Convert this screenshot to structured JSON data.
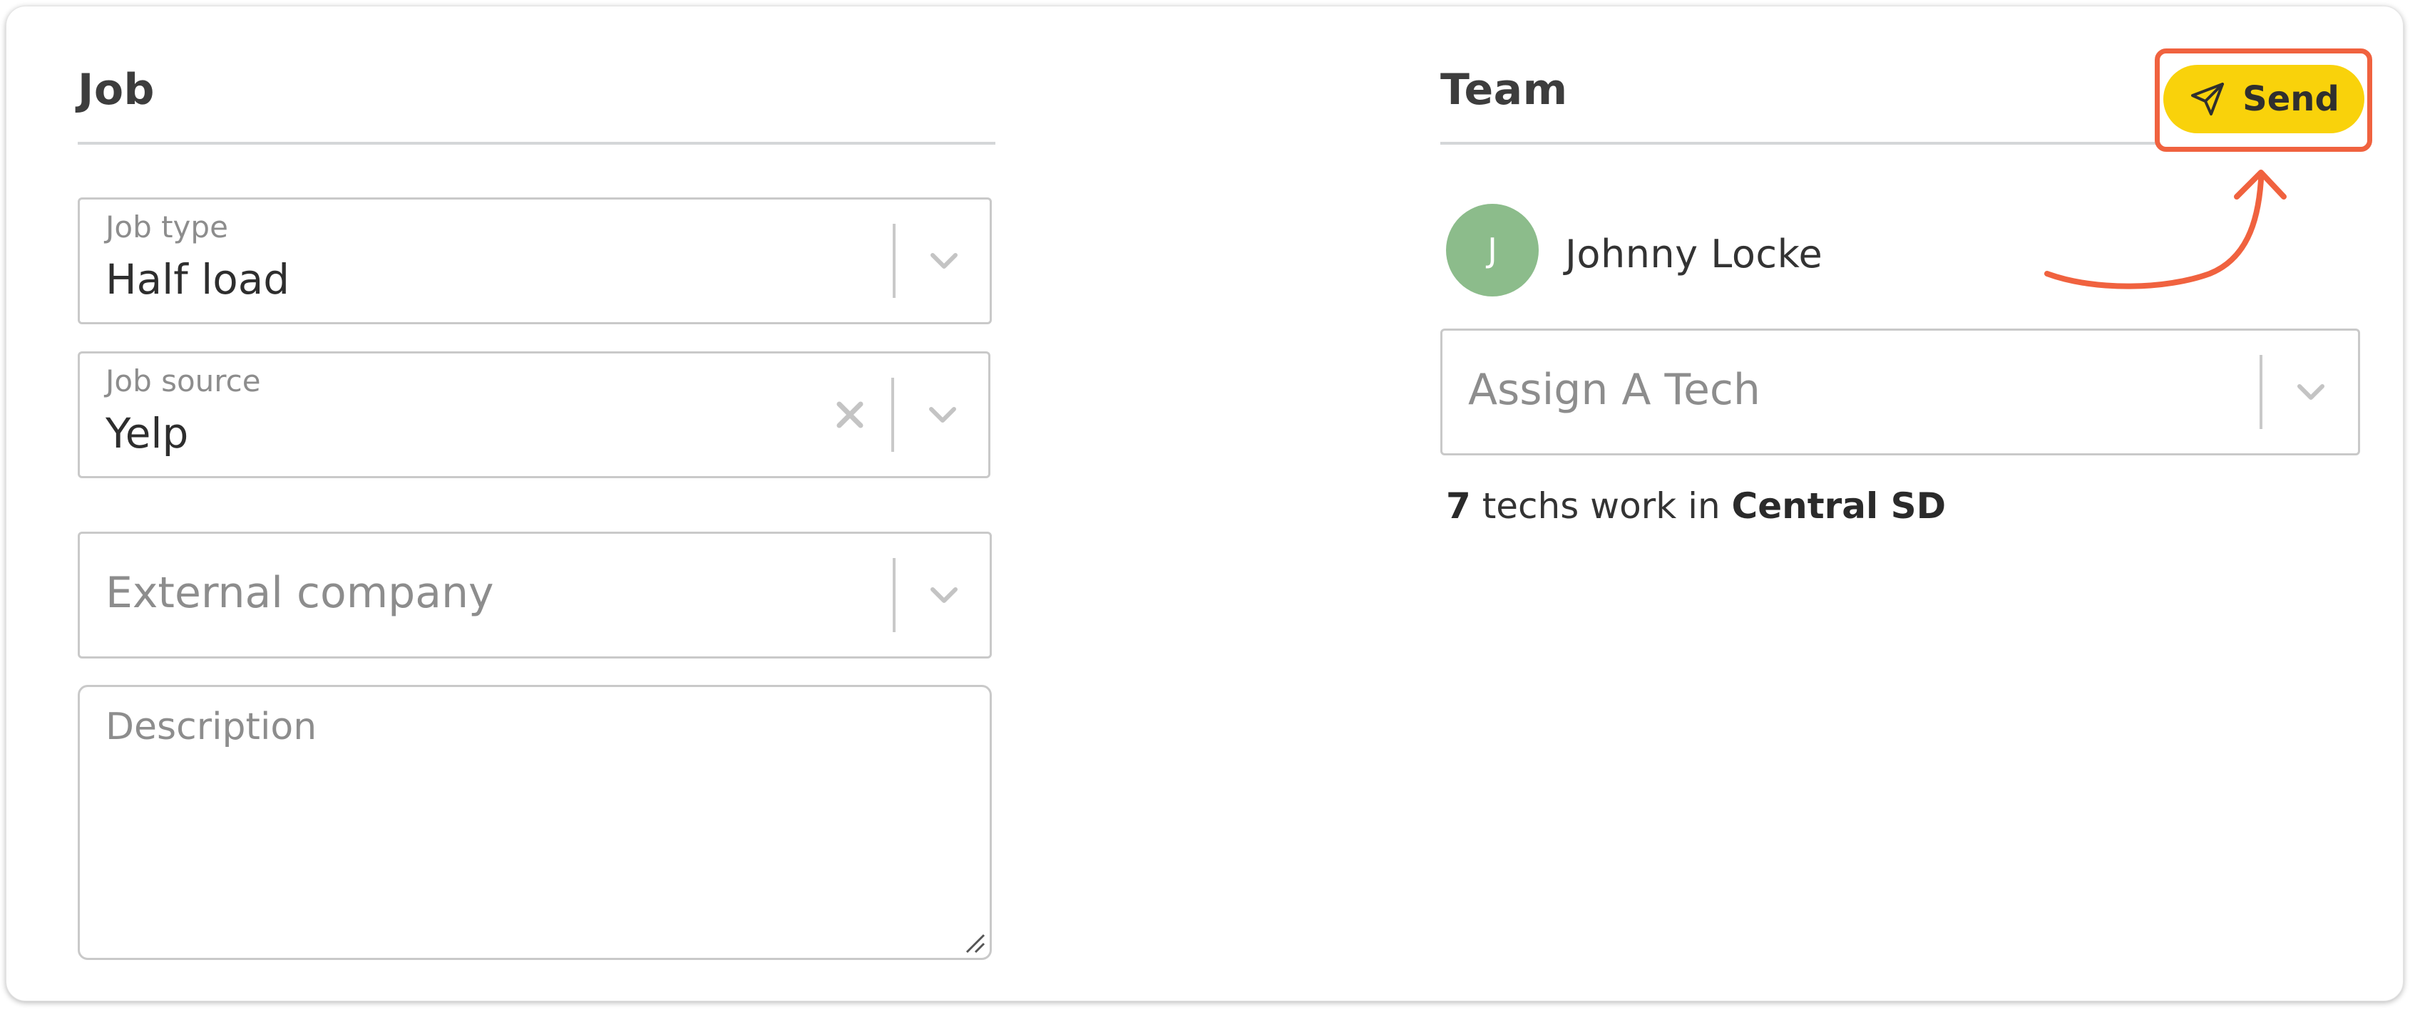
{
  "job": {
    "title": "Job",
    "job_type": {
      "label": "Job type",
      "value": "Half load"
    },
    "job_source": {
      "label": "Job source",
      "value": "Yelp"
    },
    "external_company": {
      "placeholder": "External company"
    },
    "description": {
      "placeholder": "Description"
    }
  },
  "team": {
    "title": "Team",
    "send_label": "Send",
    "member": {
      "initial": "J",
      "name": "Johnny Locke"
    },
    "assign": {
      "placeholder": "Assign A Tech"
    },
    "techs": {
      "count": "7",
      "middle": " techs work in ",
      "area": "Central SD"
    }
  },
  "colors": {
    "send_button": "#f9d20b",
    "highlight": "#f0623f",
    "avatar": "#8cbc8b"
  },
  "icons": [
    "chevron-down-icon",
    "clear-icon",
    "send-icon",
    "resize-grip-icon",
    "annotation-arrow"
  ]
}
